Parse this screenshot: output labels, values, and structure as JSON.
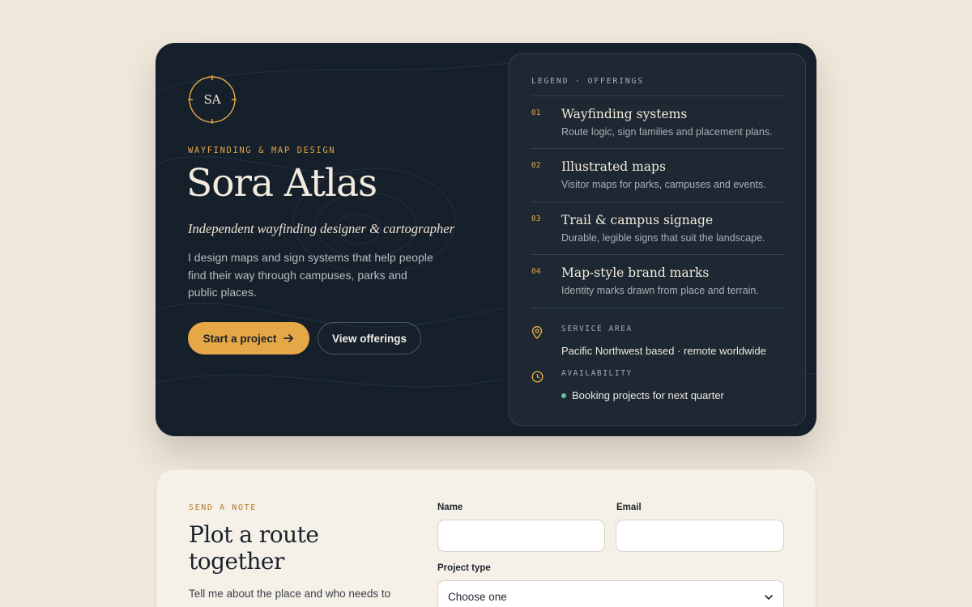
{
  "hero": {
    "logo_initials": "SA",
    "eyebrow": "WAYFINDING & MAP DESIGN",
    "title": "Sora Atlas",
    "subtitle": "Independent wayfinding designer & cartographer",
    "description": "I design maps and sign systems that help people find their way through campuses, parks and public places.",
    "primary_button": "Start a project",
    "secondary_button": "View offerings"
  },
  "legend": {
    "heading": "LEGEND · OFFERINGS",
    "offerings": [
      {
        "num": "01",
        "title": "Wayfinding systems",
        "desc": "Route logic, sign families and placement plans."
      },
      {
        "num": "02",
        "title": "Illustrated maps",
        "desc": "Visitor maps for parks, campuses and events."
      },
      {
        "num": "03",
        "title": "Trail & campus signage",
        "desc": "Durable, legible signs that suit the landscape."
      },
      {
        "num": "04",
        "title": "Map-style brand marks",
        "desc": "Identity marks drawn from place and terrain."
      }
    ],
    "service_area_label": "SERVICE AREA",
    "service_area_value": "Pacific Northwest based · remote worldwide",
    "availability_label": "AVAILABILITY",
    "availability_value": "Booking projects for next quarter"
  },
  "note": {
    "eyebrow": "SEND A NOTE",
    "title": "Plot a route together",
    "description": "Tell me about the place and who needs to",
    "name_label": "Name",
    "email_label": "Email",
    "project_type_label": "Project type",
    "project_type_value": "Choose one"
  },
  "colors": {
    "background": "#efe7da",
    "hero_bg": "#16202b",
    "accent": "#e6a846",
    "status_available": "#67c08f"
  },
  "icons": [
    "compass-icon",
    "arrow-right-icon",
    "map-pin-icon",
    "clock-icon",
    "chevron-down-icon"
  ]
}
